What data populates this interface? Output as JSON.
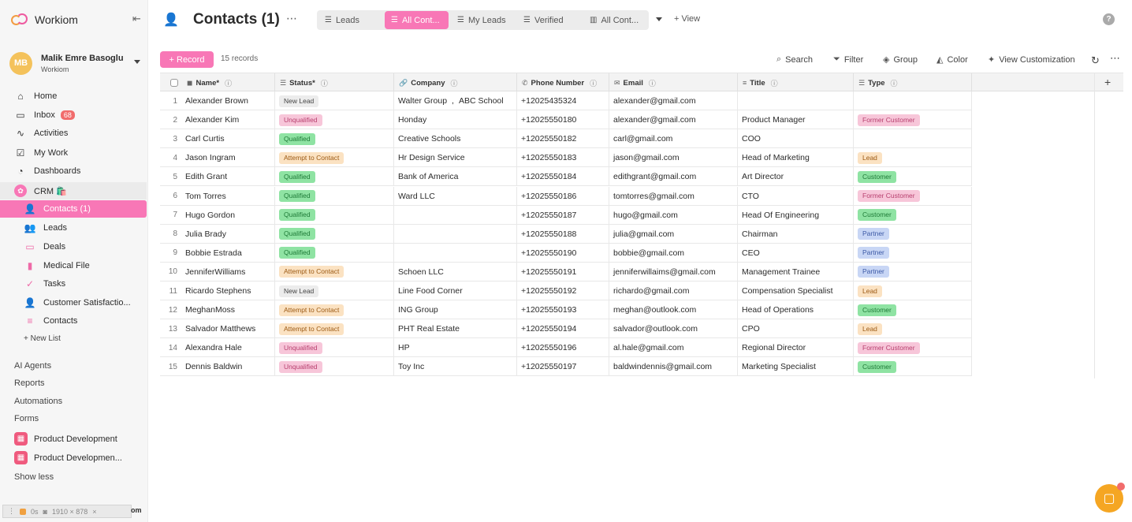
{
  "colors": {
    "accent": "#f877b6",
    "status": {
      "New Lead": "#ececec",
      "Unqualified": "#f7c6d9",
      "Qualified": "#8fe3a3",
      "Attempt to Contact": "#fbe2c2"
    },
    "status_text": {
      "New Lead": "#444444",
      "Unqualified": "#b8406f",
      "Qualified": "#1e7a37",
      "Attempt to Contact": "#9c5a14"
    },
    "type": {
      "Former Customer": "#f7c6d9",
      "Lead": "#fbe2c2",
      "Customer": "#8fe3a3",
      "Partner": "#c8d6f5"
    },
    "type_text": {
      "Former Customer": "#b8406f",
      "Lead": "#9c5a14",
      "Customer": "#1e7a37",
      "Partner": "#3d5aa6"
    }
  },
  "sidebar": {
    "brand": "Workiom",
    "user": {
      "initials": "MB",
      "name": "Malik Emre Basoglu",
      "org": "Workiom"
    },
    "main_items": [
      {
        "label": "Home",
        "icon": "home-icon"
      },
      {
        "label": "Inbox",
        "icon": "inbox-icon",
        "badge": "68"
      },
      {
        "label": "Activities",
        "icon": "activity-icon"
      },
      {
        "label": "My Work",
        "icon": "checkbox-icon"
      },
      {
        "label": "Dashboards",
        "icon": "dashboard-icon"
      },
      {
        "label": "CRM 🛍️",
        "icon": "crm-icon"
      }
    ],
    "crm_items": [
      {
        "label": "Contacts (1)",
        "icon": "contact-icon"
      },
      {
        "label": "Leads",
        "icon": "leads-icon"
      },
      {
        "label": "Deals",
        "icon": "deals-icon"
      },
      {
        "label": "Medical File",
        "icon": "file-icon"
      },
      {
        "label": "Tasks",
        "icon": "check-icon"
      },
      {
        "label": "Customer Satisfactio...",
        "icon": "person-icon"
      },
      {
        "label": "Contacts",
        "icon": "list-icon"
      }
    ],
    "new_list": "+ New List",
    "sections": [
      "AI Agents",
      "Reports",
      "Automations",
      "Forms"
    ],
    "pinned": [
      "Product Development",
      "Product Developmen..."
    ],
    "show_less": "Show less",
    "devbar": {
      "timer": "0s",
      "size": "1910 × 878",
      "tail": "om"
    }
  },
  "header": {
    "title": "Contacts (1)",
    "views": [
      "Leads",
      "All Cont...",
      "My Leads",
      "Verified",
      "All Cont..."
    ],
    "add_view": "+ View"
  },
  "toolbar": {
    "record": "+ Record",
    "count": "15 records",
    "search": "Search",
    "filter": "Filter",
    "group": "Group",
    "color": "Color",
    "customize": "View Customization"
  },
  "table": {
    "columns": [
      "Name*",
      "Status*",
      "Company",
      "Phone Number",
      "Email",
      "Title",
      "Type"
    ],
    "rows": [
      {
        "n": "1",
        "name": "Alexander Brown",
        "status": "New Lead",
        "company": [
          "Walter Group",
          "ABC School"
        ],
        "phone": "+12025435324",
        "email": "alexander@gmail.com",
        "title": "",
        "type": ""
      },
      {
        "n": "2",
        "name": "Alexander Kim",
        "status": "Unqualified",
        "company": [
          "Honday"
        ],
        "phone": "+12025550180",
        "email": "alexander@gmail.com",
        "title": "Product Manager",
        "type": "Former Customer"
      },
      {
        "n": "3",
        "name": "Carl Curtis",
        "status": "Qualified",
        "company": [
          "Creative Schools"
        ],
        "phone": "+12025550182",
        "email": "carl@gmail.com",
        "title": "COO",
        "type": ""
      },
      {
        "n": "4",
        "name": "Jason Ingram",
        "status": "Attempt to Contact",
        "company": [
          "Hr Design Service"
        ],
        "phone": "+12025550183",
        "email": "jason@gmail.com",
        "title": "Head of Marketing",
        "type": "Lead"
      },
      {
        "n": "5",
        "name": "Edith Grant",
        "status": "Qualified",
        "company": [
          "Bank of America"
        ],
        "phone": "+12025550184",
        "email": "edithgrant@gmail.com",
        "title": "Art Director",
        "type": "Customer"
      },
      {
        "n": "6",
        "name": "Tom Torres",
        "status": "Qualified",
        "company": [
          "Ward LLC"
        ],
        "phone": "+12025550186",
        "email": "tomtorres@gmail.com",
        "title": "CTO",
        "type": "Former Customer"
      },
      {
        "n": "7",
        "name": "Hugo Gordon",
        "status": "Qualified",
        "company": [],
        "phone": "+12025550187",
        "email": "hugo@gmail.com",
        "title": "Head Of Engineering",
        "type": "Customer"
      },
      {
        "n": "8",
        "name": "Julia Brady",
        "status": "Qualified",
        "company": [],
        "phone": "+12025550188",
        "email": "julia@gmail.com",
        "title": "Chairman",
        "type": "Partner"
      },
      {
        "n": "9",
        "name": "Bobbie Estrada",
        "status": "Qualified",
        "company": [],
        "phone": "+12025550190",
        "email": "bobbie@gmail.com",
        "title": "CEO",
        "type": "Partner"
      },
      {
        "n": "10",
        "name": "JenniferWilliams",
        "status": "Attempt to Contact",
        "company": [
          "Schoen LLC"
        ],
        "phone": "+12025550191",
        "email": "jenniferwillaims@gmail.com",
        "title": "Management Trainee",
        "type": "Partner"
      },
      {
        "n": "11",
        "name": "Ricardo Stephens",
        "status": "New Lead",
        "company": [
          "Line Food Corner"
        ],
        "phone": "+12025550192",
        "email": "richardo@gmail.com",
        "title": "Compensation Specialist",
        "type": "Lead"
      },
      {
        "n": "12",
        "name": "MeghanMoss",
        "status": "Attempt to Contact",
        "company": [
          "ING Group"
        ],
        "phone": "+12025550193",
        "email": "meghan@outlook.com",
        "title": "Head of Operations",
        "type": "Customer"
      },
      {
        "n": "13",
        "name": "Salvador Matthews",
        "status": "Attempt to Contact",
        "company": [
          "PHT Real Estate"
        ],
        "phone": "+12025550194",
        "email": "salvador@outlook.com",
        "title": "CPO",
        "type": "Lead"
      },
      {
        "n": "14",
        "name": "Alexandra Hale",
        "status": "Unqualified",
        "company": [
          "HP"
        ],
        "phone": "+12025550196",
        "email": "al.hale@gmail.com",
        "title": "Regional Director",
        "type": "Former Customer"
      },
      {
        "n": "15",
        "name": "Dennis Baldwin",
        "status": "Unqualified",
        "company": [
          "Toy Inc"
        ],
        "phone": "+12025550197",
        "email": "baldwindennis@gmail.com",
        "title": "Marketing Specialist",
        "type": "Customer"
      }
    ]
  }
}
